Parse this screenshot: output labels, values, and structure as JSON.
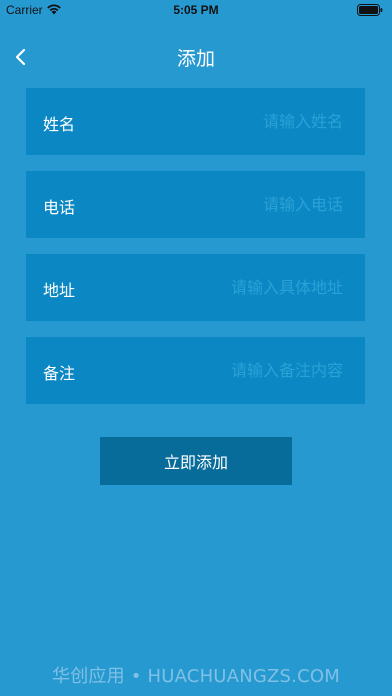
{
  "status_bar": {
    "carrier": "Carrier",
    "time": "5:05 PM",
    "wifi_icon": "wifi-icon",
    "battery_icon": "battery-icon"
  },
  "nav": {
    "title": "添加",
    "back_icon": "chevron-left-icon"
  },
  "form": {
    "fields": [
      {
        "label": "姓名",
        "placeholder": "请输入姓名",
        "value": ""
      },
      {
        "label": "电话",
        "placeholder": "请输入电话",
        "value": ""
      },
      {
        "label": "地址",
        "placeholder": "请输入具体地址",
        "value": ""
      },
      {
        "label": "备注",
        "placeholder": "请输入备注内容",
        "value": ""
      }
    ],
    "submit_label": "立即添加"
  },
  "watermark": "华创应用 • HUACHUANGZS.COM",
  "colors": {
    "background": "#2799d1",
    "field_background": "#0b88c4",
    "button_background": "#086c9b",
    "placeholder": "#2ba1d6",
    "text": "#ffffff"
  }
}
